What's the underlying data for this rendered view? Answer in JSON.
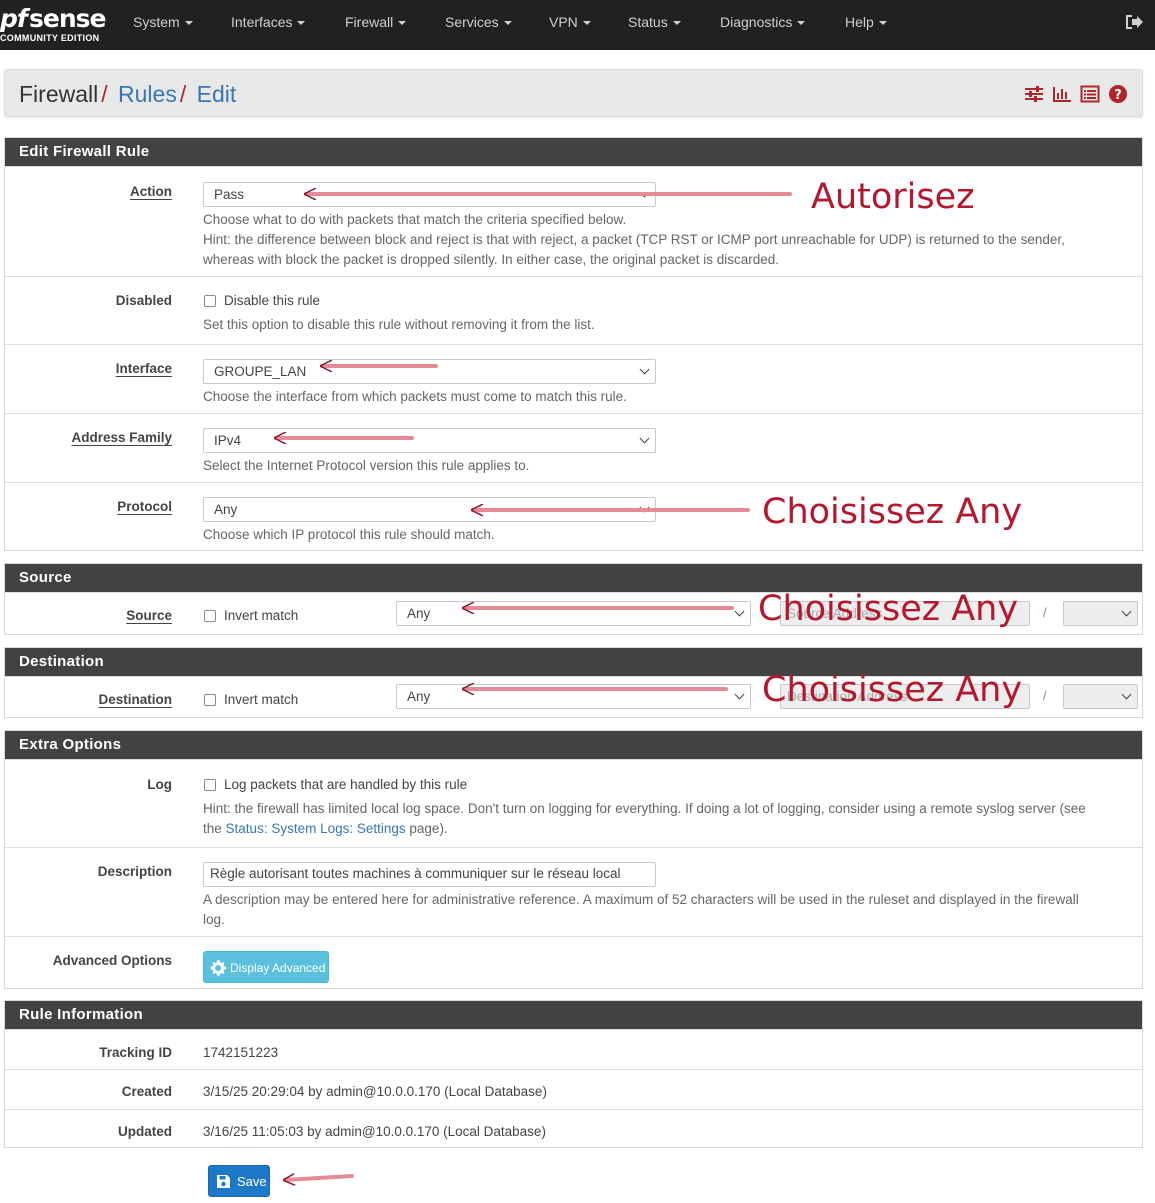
{
  "brand": {
    "logo_pf": "pf",
    "logo_sense": "sense",
    "logo_edition": "COMMUNITY EDITION"
  },
  "nav": {
    "items": [
      {
        "label": "System"
      },
      {
        "label": "Interfaces"
      },
      {
        "label": "Firewall"
      },
      {
        "label": "Services"
      },
      {
        "label": "VPN"
      },
      {
        "label": "Status"
      },
      {
        "label": "Diagnostics"
      },
      {
        "label": "Help"
      }
    ],
    "logout_icon": "logout-icon"
  },
  "breadcrumb": {
    "part1": "Firewall",
    "part2": "Rules",
    "part3": "Edit",
    "sep": "/"
  },
  "edit_rule": {
    "title": "Edit Firewall Rule",
    "action": {
      "label": "Action",
      "value": "Pass",
      "help1": "Choose what to do with packets that match the criteria specified below.",
      "help2": "Hint: the difference between block and reject is that with reject, a packet (TCP RST or ICMP port unreachable for UDP) is returned to the sender,",
      "help3": "whereas with block the packet is dropped silently. In either case, the original packet is discarded."
    },
    "disabled": {
      "label": "Disabled",
      "checkbox_label": "Disable this rule",
      "checked": false,
      "help": "Set this option to disable this rule without removing it from the list."
    },
    "interface": {
      "label": "Interface",
      "value": "GROUPE_LAN",
      "help": "Choose the interface from which packets must come to match this rule."
    },
    "address_family": {
      "label": "Address Family",
      "value": "IPv4",
      "help": "Select the Internet Protocol version this rule applies to."
    },
    "protocol": {
      "label": "Protocol",
      "value": "Any",
      "help": "Choose which IP protocol this rule should match."
    }
  },
  "source": {
    "title": "Source",
    "label": "Source",
    "invert_label": "Invert match",
    "invert_checked": false,
    "type_value": "Any",
    "address_placeholder": "Source Address",
    "slash": "/"
  },
  "destination": {
    "title": "Destination",
    "label": "Destination",
    "invert_label": "Invert match",
    "invert_checked": false,
    "type_value": "Any",
    "address_placeholder": "Destination Address",
    "slash": "/"
  },
  "extra": {
    "title": "Extra Options",
    "log": {
      "label": "Log",
      "checkbox_label": "Log packets that are handled by this rule",
      "checked": false,
      "help1": "Hint: the firewall has limited local log space. Don't turn on logging for everything. If doing a lot of logging, consider using a remote syslog server (see",
      "help2_pre": "the",
      "help2_link": "Status: System Logs: Settings",
      "help2_post": "page)."
    },
    "description": {
      "label": "Description",
      "value": "Règle autorisant toutes machines à communiquer sur le réseau local",
      "help1": "A description may be entered here for administrative reference. A maximum of 52 characters will be used in the ruleset and displayed in the firewall",
      "help2": "log."
    },
    "advanced": {
      "label": "Advanced Options",
      "button": "Display Advanced"
    }
  },
  "rule_info": {
    "title": "Rule Information",
    "tracking": {
      "label": "Tracking ID",
      "value": "1742151223"
    },
    "created": {
      "label": "Created",
      "value": "3/15/25 20:29:04 by admin@10.0.0.170 (Local Database)"
    },
    "updated": {
      "label": "Updated",
      "value": "3/16/25 11:05:03 by admin@10.0.0.170 (Local Database)"
    }
  },
  "save_button": "Save",
  "annotations": {
    "action": "Autorisez",
    "protocol": "Choisissez   Any",
    "source": "Choisissez   Any",
    "destination": "Choisissez   Any"
  },
  "colors": {
    "navbar": "#212121",
    "panel_header": "#424242",
    "link": "#3a76b3",
    "annotation": "#b5172e",
    "info_button": "#5bc0de",
    "save_button": "#1e78c8"
  }
}
